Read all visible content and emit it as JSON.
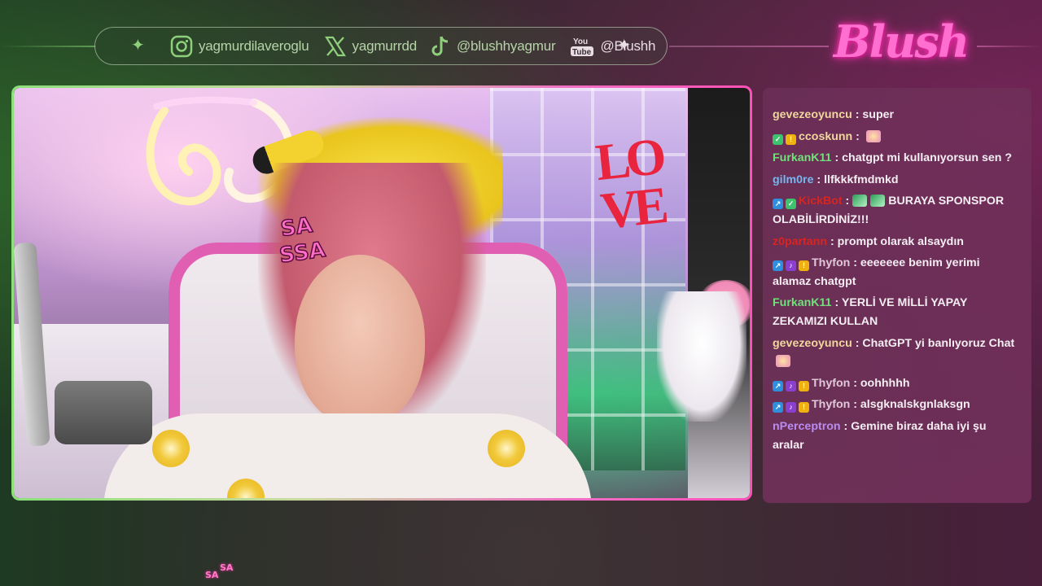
{
  "socials": {
    "instagram": {
      "handle": "yagmurdilaveroglu",
      "icon": "instagram-icon"
    },
    "x": {
      "handle": "yagmurrdd",
      "icon": "x-logo-icon"
    },
    "tiktok": {
      "handle": "@blushhyagmur",
      "icon": "tiktok-icon"
    },
    "youtube": {
      "handle": "@Blushh",
      "icon": "youtube-icon",
      "icon_text_top": "You",
      "icon_text_bottom": "Tube"
    }
  },
  "logo": {
    "text": "Blush",
    "color": "#ff6fcf"
  },
  "video": {
    "sticker_text_top": "SA",
    "sticker_text_bottom": "SSA",
    "wall_sign": "LO\nVE"
  },
  "chat": {
    "messages": [
      {
        "user": "gevezeoyuncu",
        "user_color": "#f0d79c",
        "text": "super",
        "badges": []
      },
      {
        "user": "ccoskunn",
        "user_color": "#f0d79c",
        "text": "",
        "badges": [
          "green",
          "gold"
        ],
        "emote": true
      },
      {
        "user": "FurkanK11",
        "user_color": "#6fe27a",
        "text": "chatgpt mi kullanıyorsun sen ?",
        "badges": []
      },
      {
        "user": "gilm0re",
        "user_color": "#74b7ef",
        "text": "llfkkkfmdmkd",
        "badges": []
      },
      {
        "user": "KickBot",
        "user_color": "#d9241f",
        "text": "BURAYA SPONSPOR OLABİLİRDİNİZ!!!",
        "badges": [
          "blue",
          "green"
        ],
        "emote_prefix": true
      },
      {
        "user": "z0partann",
        "user_color": "#d9241f",
        "text": "prompt olarak alsaydın",
        "badges": []
      },
      {
        "user": "Thyfon",
        "user_color": "#e0c8d8",
        "text": "eeeeeee benim yerimi alamaz chatgpt",
        "badges": [
          "blue",
          "purple",
          "gold"
        ]
      },
      {
        "user": "FurkanK11",
        "user_color": "#6fe27a",
        "text": "YERLİ VE MİLLİ YAPAY ZEKAMIZI KULLAN",
        "badges": []
      },
      {
        "user": "gevezeoyuncu",
        "user_color": "#f0d79c",
        "text": "ChatGPT yi banlıyoruz Chat",
        "badges": [],
        "emote": true
      },
      {
        "user": "Thyfon",
        "user_color": "#e0c8d8",
        "text": "oohhhhh",
        "badges": [
          "blue",
          "purple",
          "gold"
        ]
      },
      {
        "user": "Thyfon",
        "user_color": "#e0c8d8",
        "text": "alsgknalskgnlaksgn",
        "badges": [
          "blue",
          "purple",
          "gold"
        ]
      },
      {
        "user": "nPerceptron",
        "user_color": "#b88cf0",
        "text": "Gemine biraz daha iyi şu aralar",
        "badges": []
      }
    ]
  },
  "bottom_sticker": {
    "line1": "SA",
    "line2": "SA"
  }
}
